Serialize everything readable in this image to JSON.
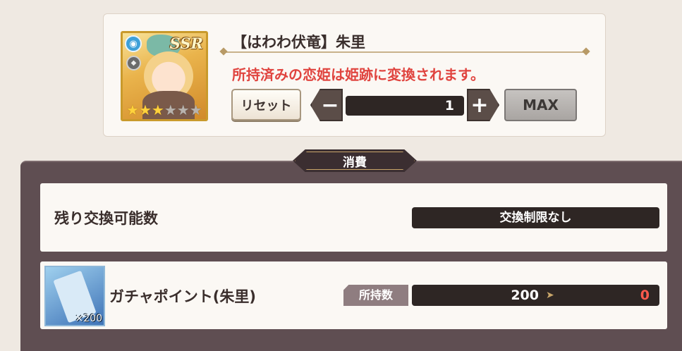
{
  "character": {
    "rarity": "SSR",
    "name": "【はわわ伏竜】朱里",
    "stars_filled": 3,
    "stars_total": 6,
    "notice": "所持済みの恋姫は姫跡に変換されます。"
  },
  "controls": {
    "reset_label": "リセット",
    "minus_label": "−",
    "quantity": "1",
    "plus_label": "+",
    "max_label": "MAX"
  },
  "panel": {
    "title": "消費",
    "remaining": {
      "label": "残り交換可能数",
      "value": "交換制限なし"
    },
    "item": {
      "name": "ガチャポイント(朱里)",
      "icon_count": "×200",
      "owned_label": "所持数",
      "owned_before": "200",
      "owned_after": "0"
    }
  },
  "colors": {
    "notice": "#e0443f",
    "after_value": "#ff5a4d",
    "panel_bg": "#5f4e52"
  }
}
